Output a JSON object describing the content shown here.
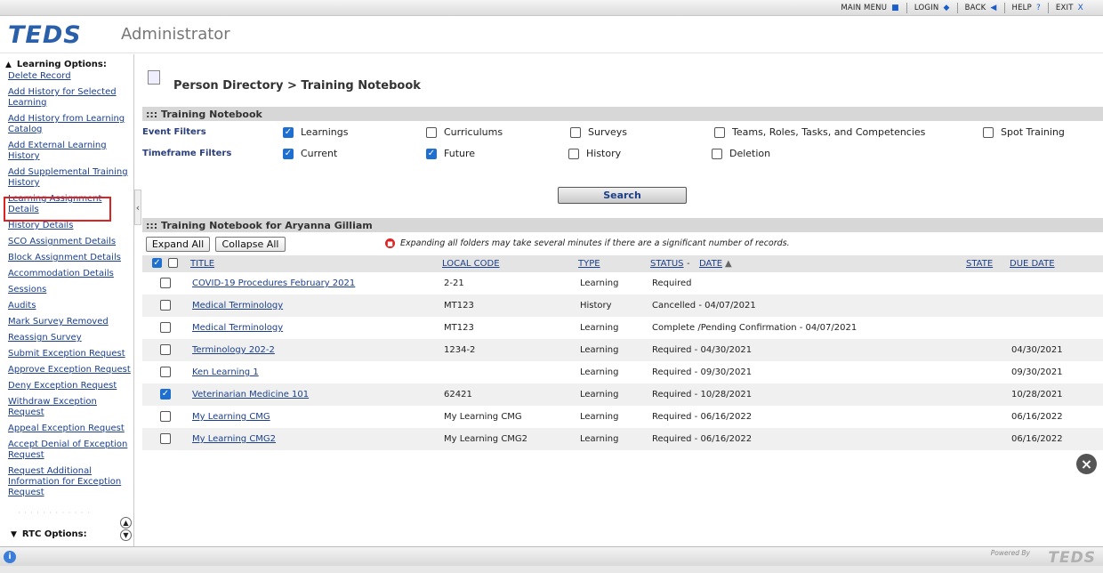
{
  "topnav": [
    {
      "label": "MAIN MENU",
      "icon": "■"
    },
    {
      "label": "LOGIN",
      "icon": "◆"
    },
    {
      "label": "BACK",
      "icon": "◀"
    },
    {
      "label": "HELP",
      "icon": "?"
    },
    {
      "label": "EXIT",
      "icon": "X"
    }
  ],
  "header": {
    "logo": "TEDS",
    "app": "Administrator"
  },
  "sidebar": {
    "learning_heading": "Learning Options:",
    "items": [
      "Delete Record",
      "Add History for Selected Learning",
      "Add History from Learning Catalog",
      "Add External Learning History",
      "Add Supplemental Training History",
      "Learning Assignment Details",
      "History Details",
      "SCO Assignment Details",
      "Block Assignment Details",
      "Accommodation Details",
      "Sessions",
      "Audits",
      "Mark Survey Removed",
      "Reassign Survey",
      "Submit Exception Request",
      "Approve Exception Request",
      "Deny Exception Request",
      "Withdraw Exception Request",
      "Appeal Exception Request",
      "Accept Denial of Exception Request",
      "Request Additional Information for Exception Request"
    ],
    "rtc_heading": "RTC Options:"
  },
  "page": {
    "title": "Person Directory > Training Notebook"
  },
  "filters": {
    "section_title": "::: Training Notebook",
    "event_label": "Event Filters",
    "timeframe_label": "Timeframe Filters",
    "event": [
      {
        "label": "Learnings",
        "checked": true
      },
      {
        "label": "Curriculums",
        "checked": false
      },
      {
        "label": "Surveys",
        "checked": false
      },
      {
        "label": "Teams, Roles, Tasks, and Competencies",
        "checked": false
      },
      {
        "label": "Spot Training",
        "checked": false
      }
    ],
    "timeframe": [
      {
        "label": "Current",
        "checked": true
      },
      {
        "label": "Future",
        "checked": true
      },
      {
        "label": "History",
        "checked": false
      },
      {
        "label": "Deletion",
        "checked": false
      }
    ],
    "search_label": "Search"
  },
  "results": {
    "section_title": "::: Training Notebook for Aryanna Gilliam",
    "expand_label": "Expand All",
    "collapse_label": "Collapse All",
    "warning": "Expanding all folders may take several minutes if there are a significant number of records.",
    "columns": {
      "title": "TITLE",
      "local_code": "LOCAL CODE",
      "type": "TYPE",
      "status": "STATUS",
      "date": "DATE",
      "state": "STATE",
      "due_date": "DUE DATE"
    },
    "rows": [
      {
        "title": "COVID-19 Procedures February 2021",
        "code": "2-21",
        "type": "Learning",
        "status": "Required",
        "due": "",
        "checked": false
      },
      {
        "title": "Medical Terminology",
        "code": "MT123",
        "type": "History",
        "status": "Cancelled  - 04/07/2021",
        "due": "",
        "checked": false
      },
      {
        "title": "Medical Terminology",
        "code": "MT123",
        "type": "Learning",
        "status": "Complete /Pending Confirmation  - 04/07/2021",
        "due": "",
        "checked": false
      },
      {
        "title": "Terminology 202-2",
        "code": "1234-2",
        "type": "Learning",
        "status": "Required  - 04/30/2021",
        "due": "04/30/2021",
        "checked": false
      },
      {
        "title": "Ken Learning 1",
        "code": "",
        "type": "Learning",
        "status": "Required  - 09/30/2021",
        "due": "09/30/2021",
        "checked": false
      },
      {
        "title": "Veterinarian Medicine 101",
        "code": "62421",
        "type": "Learning",
        "status": "Required  - 10/28/2021",
        "due": "10/28/2021",
        "checked": true
      },
      {
        "title": "My Learning CMG",
        "code": "My Learning CMG",
        "type": "Learning",
        "status": "Required  - 06/16/2022",
        "due": "06/16/2022",
        "checked": false
      },
      {
        "title": "My Learning CMG2",
        "code": "My Learning CMG2",
        "type": "Learning",
        "status": "Required  - 06/16/2022",
        "due": "06/16/2022",
        "checked": false
      }
    ]
  },
  "footer": {
    "powered": "Powered By",
    "logo": "TEDS"
  }
}
